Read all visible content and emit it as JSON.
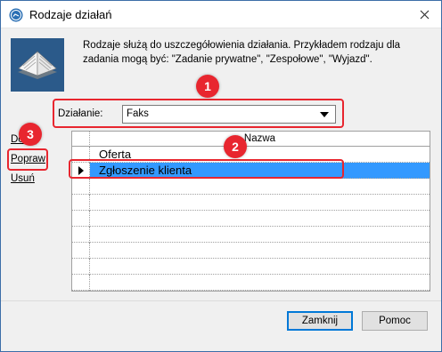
{
  "window": {
    "title": "Rodzaje działań"
  },
  "header": {
    "description": "Rodzaje służą do uszczegółowienia działania. Przykładem rodzaju dla zadania mogą być: \"Zadanie prywatne\", \"Zespołowe\", \"Wyjazd\"."
  },
  "actions": {
    "add": "Dodaj",
    "edit": "Popraw",
    "delete": "Usuń"
  },
  "filter": {
    "label": "Działanie:",
    "selected": "Faks"
  },
  "grid": {
    "column_header": "Nazwa",
    "rows": [
      {
        "name": "Oferta",
        "selected": false
      },
      {
        "name": "Zgłoszenie klienta",
        "selected": true
      }
    ]
  },
  "footer": {
    "close_label": "Zamknij",
    "help_label": "Pomoc"
  },
  "annotations": {
    "badge_1": "1",
    "badge_2": "2",
    "badge_3": "3",
    "color": "#e8262f"
  },
  "colors": {
    "selection": "#3399ff",
    "window_bg": "#f0f0f0",
    "title_accent": "#3c6ea8"
  }
}
